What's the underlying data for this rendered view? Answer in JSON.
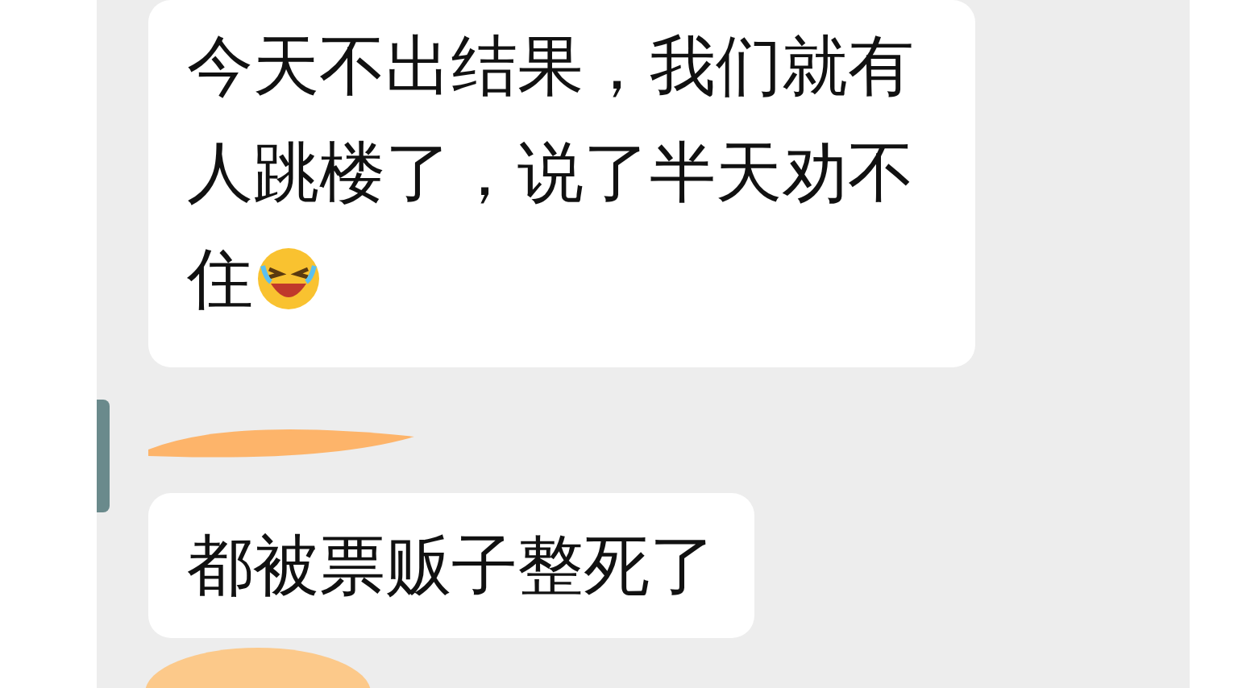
{
  "messages": [
    {
      "text": "今天不出结果，我们就有人跳楼了，说了半天劝不住",
      "has_emoji": true,
      "name_redacted": false
    },
    {
      "text": "都被票贩子整死了",
      "has_emoji": false,
      "name_redacted": true
    }
  ]
}
